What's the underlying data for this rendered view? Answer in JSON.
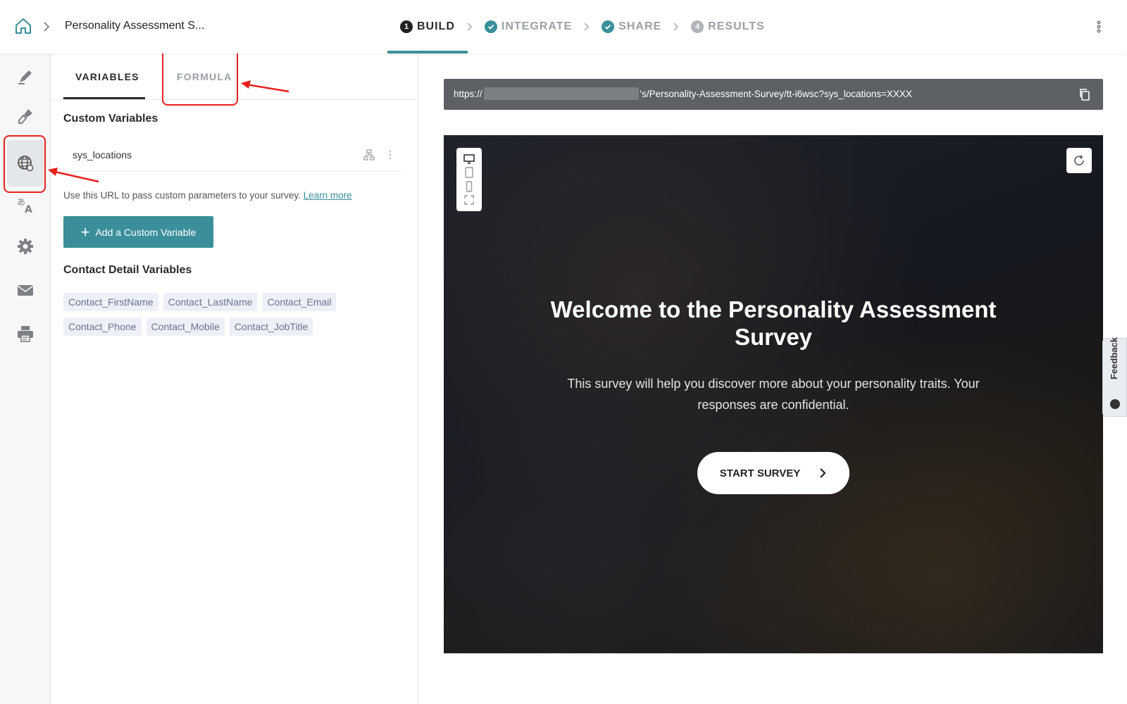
{
  "header": {
    "breadcrumb_title": "Personality Assessment S...",
    "steps": [
      {
        "num": "1",
        "label": "BUILD",
        "state": "active"
      },
      {
        "num": "",
        "label": "INTEGRATE",
        "state": "done"
      },
      {
        "num": "",
        "label": "SHARE",
        "state": "done"
      },
      {
        "num": "4",
        "label": "RESULTS",
        "state": "pending"
      }
    ]
  },
  "rail": {
    "items": [
      "edit-icon",
      "brush-icon",
      "globe-icon",
      "translate-icon",
      "gear-icon",
      "mail-icon",
      "print-icon"
    ],
    "active_item": "globe-icon"
  },
  "panel": {
    "tabs": {
      "variables": "VARIABLES",
      "formula": "FORMULA"
    },
    "custom_variables_title": "Custom Variables",
    "custom_variable": "sys_locations",
    "help_text": "Use this URL to pass custom parameters to your survey.",
    "help_link": "Learn more",
    "add_button": "Add a Custom Variable",
    "contact_title": "Contact Detail Variables",
    "contact_chips": [
      "Contact_FirstName",
      "Contact_LastName",
      "Contact_Email",
      "Contact_Phone",
      "Contact_Mobile",
      "Contact_JobTitle"
    ]
  },
  "preview": {
    "url_prefix": "https://",
    "url_suffix": "'s/Personality-Assessment-Survey/tt-i6wsc?sys_locations=XXXX",
    "welcome_title": "Welcome to the Personality Assessment Survey",
    "welcome_desc": "This survey will help you discover more about your personality traits. Your responses are confidential.",
    "start_button": "START SURVEY"
  },
  "feedback": {
    "label": "Feedback"
  },
  "colors": {
    "accent": "#3a8f9a",
    "annotation": "#e8201c"
  }
}
